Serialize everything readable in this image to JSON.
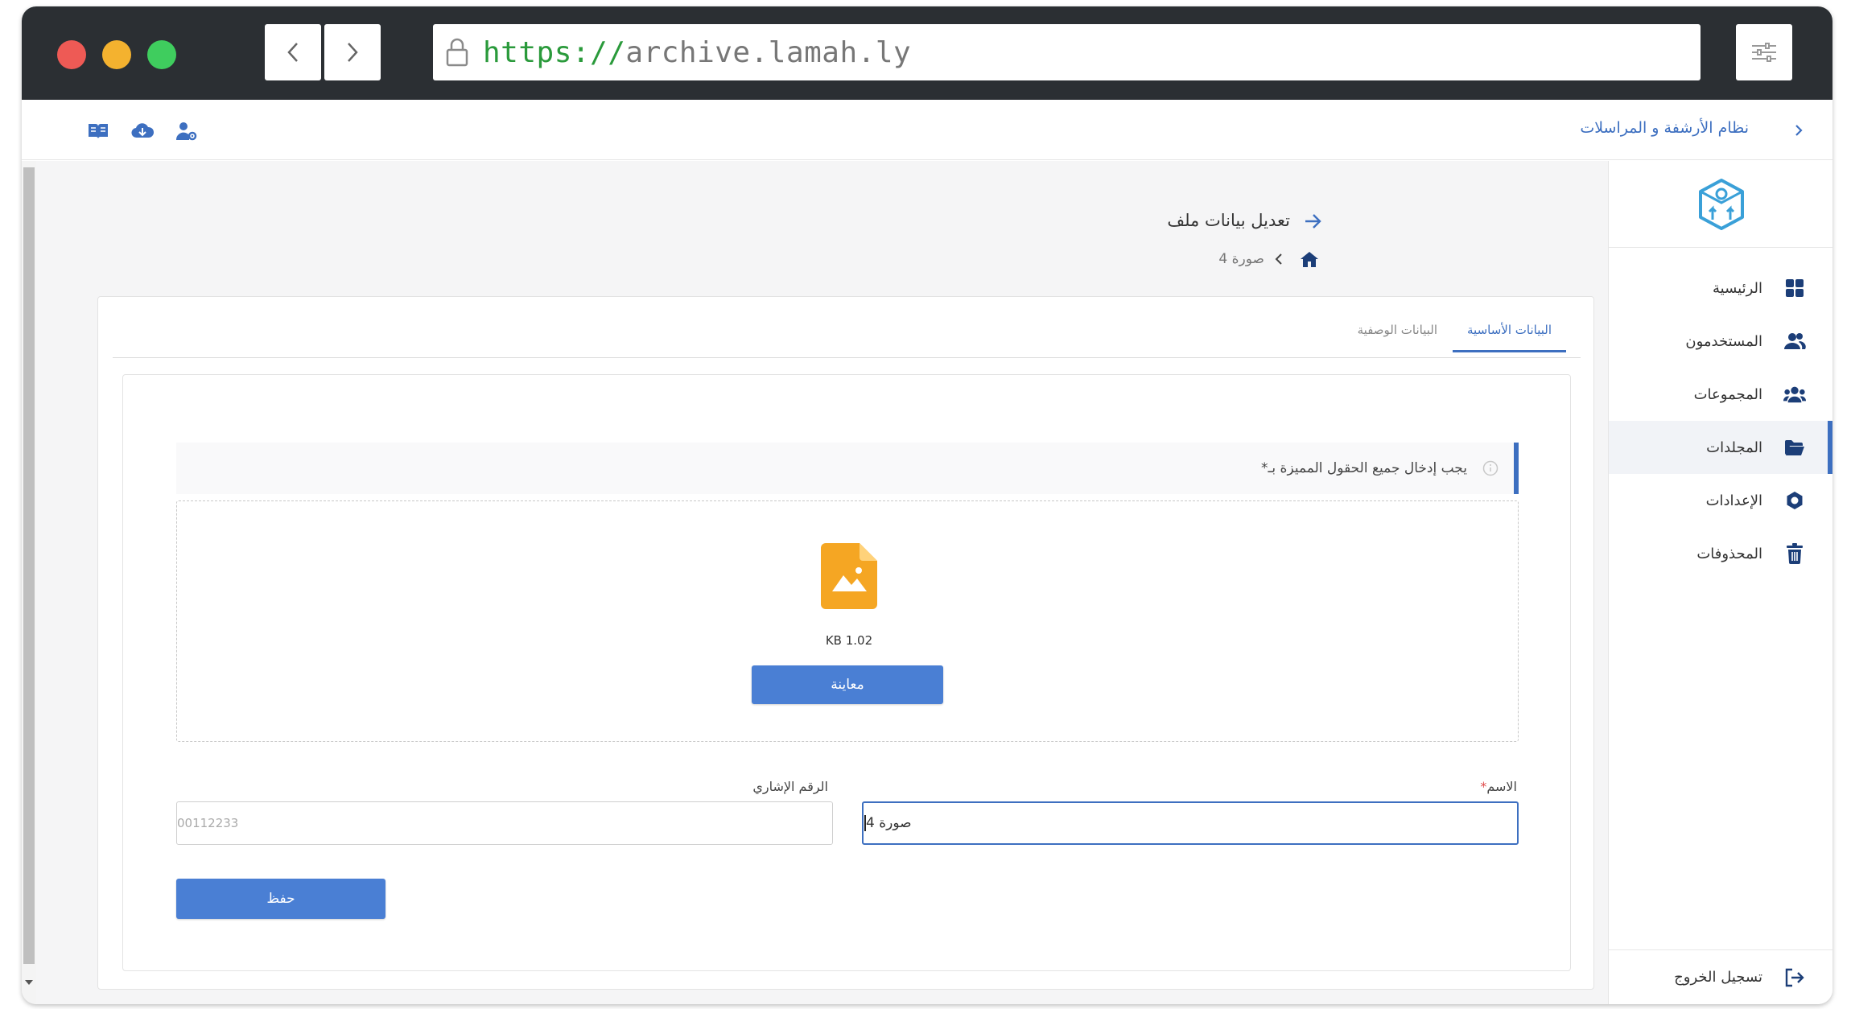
{
  "browser": {
    "url_protocol": "https://",
    "url_host": "archive.lamah.ly"
  },
  "topbar": {
    "system_title": "نظام الأرشفة و المراسلات",
    "icons": [
      "book-icon",
      "cloud-download-icon",
      "user-settings-icon"
    ]
  },
  "sidebar": {
    "items": [
      {
        "label": "الرئيسية",
        "icon": "grid-icon",
        "active": false
      },
      {
        "label": "المستخدمون",
        "icon": "users-icon",
        "active": false
      },
      {
        "label": "المجموعات",
        "icon": "group-icon",
        "active": false
      },
      {
        "label": "المجلدات",
        "icon": "folder-icon",
        "active": true
      },
      {
        "label": "الإعدادات",
        "icon": "settings-icon",
        "active": false
      },
      {
        "label": "المحذوفات",
        "icon": "trash-icon",
        "active": false
      }
    ],
    "logout_label": "تسجيل الخروج"
  },
  "page": {
    "title": "تعديل بيانات ملف",
    "breadcrumb_current": "صورة 4"
  },
  "tabs": {
    "basic": "البيانات الأساسية",
    "descriptive": "البيانات الوصفية"
  },
  "form": {
    "notice": "يجب إدخال جميع الحقول المميزة بـ*",
    "file_size": "KB 1.02",
    "preview_button": "معاينة",
    "name_label": "الاسم",
    "name_required_mark": "*",
    "name_value": "صورة 4",
    "ref_label": "الرقم الإشاري",
    "ref_value": "00112233",
    "save_button": "حفظ"
  },
  "colors": {
    "accent": "#3d6fc0",
    "button": "#4a7fd4",
    "file_icon": "#f5a623",
    "titlebar": "#2b2f33"
  }
}
